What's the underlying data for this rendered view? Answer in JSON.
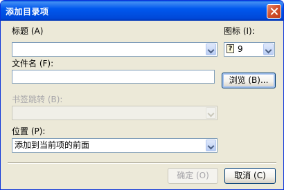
{
  "dialog": {
    "title": "添加目录项",
    "title_label": "标题 (A)",
    "title_value": "",
    "icon_label": "图标 (I):",
    "icon_value": "9",
    "filename_label": "文件名 (F):",
    "filename_value": "",
    "browse_label": "浏览 (B)...",
    "bookmark_label": "书签跳转 (B):",
    "bookmark_value": "",
    "position_label": "位置 (P):",
    "position_value": "添加到当前项的前面",
    "ok_label": "确定 (O)",
    "cancel_label": "取消 (C)"
  },
  "icons": {
    "close": "close-icon",
    "icon_preview": "help-book-icon",
    "dropdown": "chevron-down-icon"
  },
  "colors": {
    "titlebar": "#0058ee",
    "dialog_bg": "#ece9d8",
    "close_button": "#d2522f",
    "input_border": "#7f9db9",
    "disabled_text": "#a7a6aa"
  }
}
